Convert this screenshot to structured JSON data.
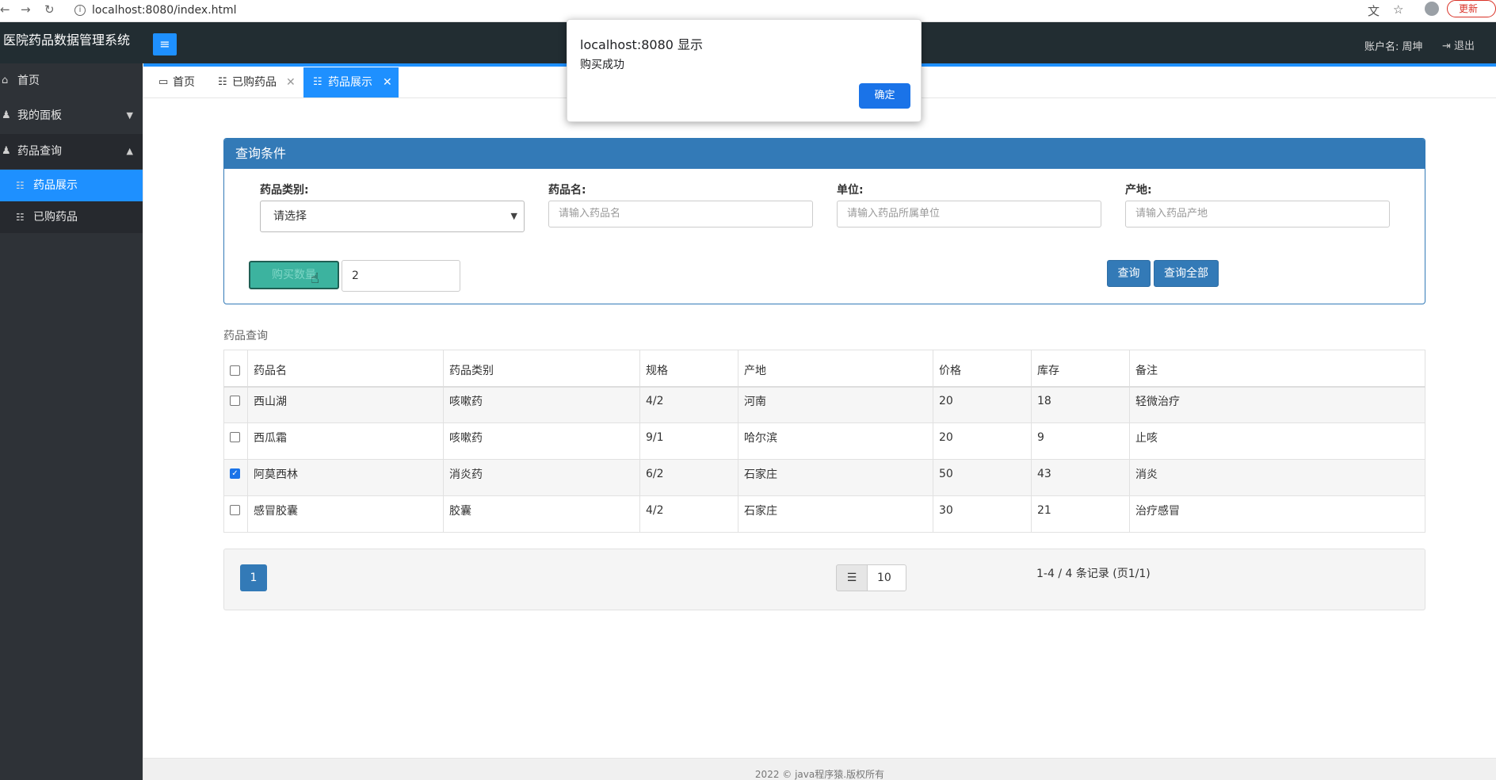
{
  "browser": {
    "url": "localhost:8080/index.html",
    "update_label": "更新"
  },
  "header": {
    "app_title": "医院药品数据管理系统",
    "account_label": "账户名: 周坤",
    "logout_label": "退出"
  },
  "sidebar": {
    "items": [
      {
        "label": "首页"
      },
      {
        "label": "我的面板"
      },
      {
        "label": "药品查询"
      }
    ],
    "sub_items": [
      {
        "label": "药品展示"
      },
      {
        "label": "已购药品"
      }
    ]
  },
  "tabs": [
    {
      "label": "首页"
    },
    {
      "label": "已购药品"
    },
    {
      "label": "药品展示"
    }
  ],
  "query_panel": {
    "title": "查询条件",
    "category_label": "药品类别:",
    "category_value": "请选择",
    "name_label": "药品名:",
    "name_placeholder": "请输入药品名",
    "unit_label": "单位:",
    "unit_placeholder": "请输入药品所属单位",
    "origin_label": "产地:",
    "origin_placeholder": "请输入药品产地",
    "buy_button": "购买数量",
    "buy_quantity": "2",
    "query_button": "查询",
    "query_all_button": "查询全部"
  },
  "table": {
    "caption": "药品查询",
    "columns": [
      "药品名",
      "药品类别",
      "规格",
      "产地",
      "价格",
      "库存",
      "备注"
    ],
    "rows": [
      {
        "checked": false,
        "cells": [
          "西山湖",
          "咳嗽药",
          "4/2",
          "河南",
          "20",
          "18",
          "轻微治疗"
        ]
      },
      {
        "checked": false,
        "cells": [
          "西瓜霜",
          "咳嗽药",
          "9/1",
          "哈尔滨",
          "20",
          "9",
          "止咳"
        ]
      },
      {
        "checked": true,
        "cells": [
          "阿莫西林",
          "消炎药",
          "6/2",
          "石家庄",
          "50",
          "43",
          "消炎"
        ]
      },
      {
        "checked": false,
        "cells": [
          "感冒胶囊",
          "胶囊",
          "4/2",
          "石家庄",
          "30",
          "21",
          "治疗感冒"
        ]
      }
    ]
  },
  "pagination": {
    "current_page": "1",
    "page_size": "10",
    "info": "1-4 / 4 条记录 (页1/1)"
  },
  "footer": {
    "text": "2022 © java程序猿.版权所有"
  },
  "dialog": {
    "title": "localhost:8080 显示",
    "message": "购买成功",
    "ok_button": "确定"
  },
  "colors": {
    "primary": "#337ab7",
    "accent_blue": "#1e90ff",
    "sidebar_bg": "#2e3237",
    "header_bg": "#222d32",
    "buy_button": "#3cb39f"
  }
}
